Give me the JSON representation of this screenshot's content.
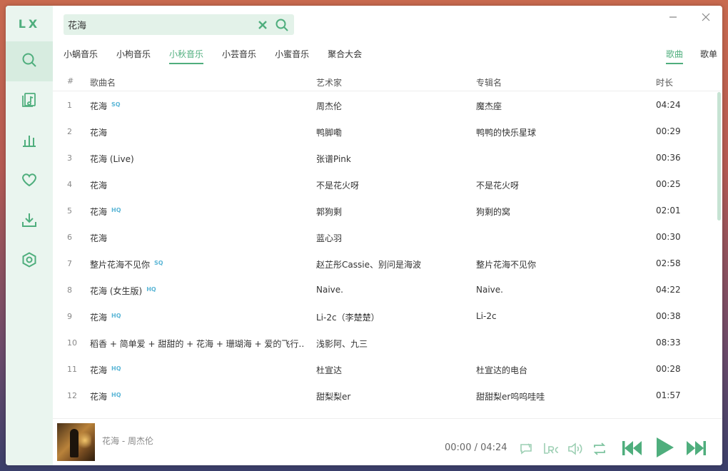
{
  "app": {
    "logo": "LX"
  },
  "sidebar": {
    "items": [
      {
        "name": "search",
        "icon": "search-icon",
        "active": true
      },
      {
        "name": "song-list",
        "icon": "music-list-icon",
        "active": false
      },
      {
        "name": "leaderboard",
        "icon": "bar-chart-icon",
        "active": false
      },
      {
        "name": "favorites",
        "icon": "heart-icon",
        "active": false
      },
      {
        "name": "download",
        "icon": "download-icon",
        "active": false
      },
      {
        "name": "settings",
        "icon": "settings-icon",
        "active": false
      }
    ]
  },
  "search": {
    "value": "花海",
    "placeholder": ""
  },
  "sources": [
    "小蜗音乐",
    "小枸音乐",
    "小秋音乐",
    "小芸音乐",
    "小蜜音乐",
    "聚合大会"
  ],
  "active_source": "小秋音乐",
  "types": [
    "歌曲",
    "歌单"
  ],
  "active_type": "歌曲",
  "table": {
    "headers": {
      "num": "#",
      "name": "歌曲名",
      "artist": "艺术家",
      "album": "专辑名",
      "duration": "时长"
    },
    "rows": [
      {
        "num": "1",
        "name": "花海",
        "quality": "SQ",
        "artist": "周杰伦",
        "album": "魔杰座",
        "duration": "04:24"
      },
      {
        "num": "2",
        "name": "花海",
        "quality": "",
        "artist": "鸭脚嘞",
        "album": "鸭鸭的快乐星球",
        "duration": "00:29"
      },
      {
        "num": "3",
        "name": "花海 (Live)",
        "quality": "",
        "artist": "张谱Pink",
        "album": "",
        "duration": "00:36"
      },
      {
        "num": "4",
        "name": "花海",
        "quality": "",
        "artist": "不是花火呀",
        "album": "不是花火呀",
        "duration": "00:25"
      },
      {
        "num": "5",
        "name": "花海",
        "quality": "HQ",
        "artist": "郭狗剩",
        "album": "狗剩的窝",
        "duration": "02:01"
      },
      {
        "num": "6",
        "name": "花海",
        "quality": "",
        "artist": "蓝心羽",
        "album": "",
        "duration": "00:30"
      },
      {
        "num": "7",
        "name": "整片花海不见你",
        "quality": "SQ",
        "artist": "赵芷彤Cassie、别问是海波",
        "album": "整片花海不见你",
        "duration": "02:58"
      },
      {
        "num": "8",
        "name": "花海 (女生版)",
        "quality": "HQ",
        "artist": "Naive.",
        "album": "Naive.",
        "duration": "04:22"
      },
      {
        "num": "9",
        "name": "花海",
        "quality": "HQ",
        "artist": "Li-2c（李楚楚）",
        "album": "Li-2c",
        "duration": "00:38"
      },
      {
        "num": "10",
        "name": "稻香 + 简单爱 + 甜甜的 + 花海 + 珊瑚海 + 爱的飞行…",
        "quality": "",
        "artist": "浅影阿、九三",
        "album": "",
        "duration": "08:33"
      },
      {
        "num": "11",
        "name": "花海",
        "quality": "HQ",
        "artist": "杜宣达",
        "album": "杜宣达的电台",
        "duration": "00:28"
      },
      {
        "num": "12",
        "name": "花海",
        "quality": "HQ",
        "artist": "甜梨梨er",
        "album": "甜甜梨er呜呜哇哇",
        "duration": "01:57"
      }
    ]
  },
  "player": {
    "track": "花海 - 周杰伦",
    "current_time": "00:00",
    "total_time": "04:24",
    "time_display": "00:00 / 04:24"
  },
  "colors": {
    "accent": "#4fae7d",
    "sidebar_bg": "#eaf5ef",
    "search_bg": "#e3f2e9",
    "badge": "#5bb6d6"
  }
}
